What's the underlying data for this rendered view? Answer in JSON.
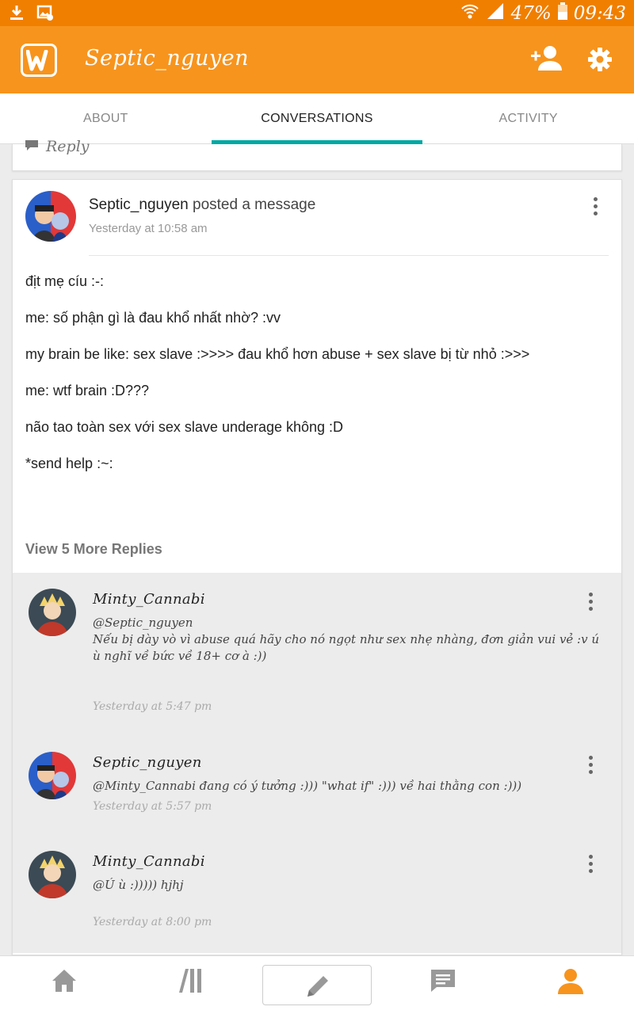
{
  "status_bar": {
    "battery": "47%",
    "time": "09:43",
    "icons": [
      "download-icon",
      "image-icon",
      "wifi-icon",
      "signal-icon",
      "battery-icon"
    ]
  },
  "app_bar": {
    "title": "Septic_nguyen",
    "logo_icon": "wattpad-logo",
    "actions": [
      "add-user-icon",
      "gear-icon"
    ]
  },
  "tabs": [
    {
      "label": "ABOUT",
      "active": false
    },
    {
      "label": "CONVERSATIONS",
      "active": true
    },
    {
      "label": "ACTIVITY",
      "active": false
    }
  ],
  "previous_card": {
    "reply_label": "Reply"
  },
  "post": {
    "author": "Septic_nguyen",
    "verb": "posted a message",
    "time": "Yesterday at 10:58 am",
    "lines": [
      "địt mẹ cíu :-:",
      "me: số phận gì là đau khổ nhất nhờ? :vv",
      "my brain be like: sex slave :>>>> đau khổ hơn abuse + sex slave bị từ nhỏ :>>>",
      "me: wtf brain :D???",
      "não tao toàn sex với sex slave underage không :D",
      "*send help :~:"
    ],
    "view_more": "View 5 More Replies"
  },
  "replies": [
    {
      "author": "Minty_Cannabi",
      "lines": [
        "@Septic_nguyen",
        "Nếu bị dày vò vì abuse quá hãy cho nó ngọt như sex nhẹ nhàng, đơn giản vui vẻ :v ú ù nghĩ về bức về 18+ cơ à :))"
      ],
      "time": "Yesterday at 5:47 pm"
    },
    {
      "author": "Septic_nguyen",
      "lines": [
        "@Minty_Cannabi đang có ý tưởng :))) \"what if\" :))) về hai thằng con :)))"
      ],
      "time": "Yesterday at 5:57 pm"
    },
    {
      "author": "Minty_Cannabi",
      "lines": [
        "@Ú ù :))))) hjhj"
      ],
      "time": "Yesterday at 8:00 pm"
    }
  ],
  "bottom_nav": [
    "home-icon",
    "library-icon",
    "pencil-icon",
    "messages-icon",
    "profile-icon"
  ],
  "colors": {
    "accent": "#f7941d",
    "status_bar": "#f07f00",
    "tab_indicator": "#00a8a3",
    "active_nav": "#f7941d"
  }
}
